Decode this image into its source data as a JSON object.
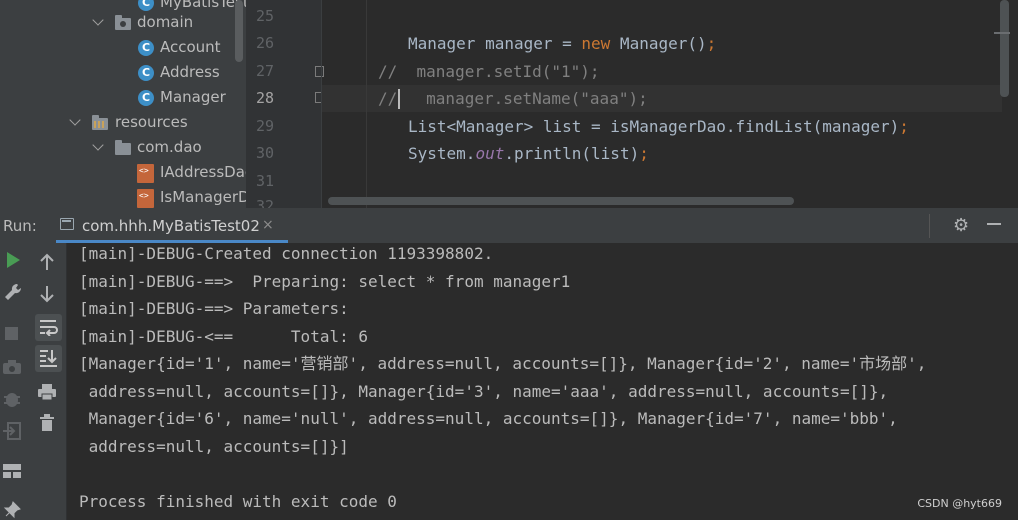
{
  "project_tree": {
    "items": [
      {
        "label": "MyBatisTest",
        "kind": "class"
      },
      {
        "label": "domain",
        "kind": "package"
      },
      {
        "label": "Account",
        "kind": "class"
      },
      {
        "label": "Address",
        "kind": "class"
      },
      {
        "label": "Manager",
        "kind": "class"
      },
      {
        "label": "resources",
        "kind": "resources"
      },
      {
        "label": "com.dao",
        "kind": "folder"
      },
      {
        "label": "IAddressDao",
        "kind": "xml"
      },
      {
        "label": "IsManagerD",
        "kind": "xml"
      }
    ]
  },
  "editor": {
    "line_numbers": [
      "25",
      "26",
      "27",
      "28",
      "29",
      "30",
      "31",
      "32"
    ],
    "current_line": "28",
    "code": {
      "l26_type": "Manager manager = ",
      "l26_new": "new",
      "l26_rest": " Manager()",
      "l26_semi": ";",
      "l27": "//  manager.setId(\"1\");",
      "l28": "//   manager.setName(\"aaa\");",
      "l29_a": "List<Manager> list = isManagerDao.findList(manager)",
      "l29_semi": ";",
      "l30_a": "System.",
      "l30_field": "out",
      "l30_b": ".println(list)",
      "l30_semi": ";"
    }
  },
  "run_panel": {
    "label": "Run:",
    "tab_title": "com.hhh.MyBatisTest02",
    "tab_close": "×",
    "settings_icon": "gear-icon",
    "minimize_icon": "minimize-icon"
  },
  "console": {
    "lines": [
      "[main]-DEBUG-Created connection 1193398802.",
      "[main]-DEBUG-==>  Preparing: select * from manager1",
      "[main]-DEBUG-==> Parameters:",
      "[main]-DEBUG-<==      Total: 6",
      "[Manager{id='1', name='营销部', address=null, accounts=[]}, Manager{id='2', name='市场部',",
      " address=null, accounts=[]}, Manager{id='3', name='aaa', address=null, accounts=[]},",
      " Manager{id='6', name='null', address=null, accounts=[]}, Manager{id='7', name='bbb',",
      " address=null, accounts=[]}]",
      "",
      "Process finished with exit code 0"
    ]
  },
  "watermark": "CSDN @hyt669",
  "colors": {
    "keyword": "#cc7832",
    "comment": "#808080",
    "static_field": "#9876aa",
    "accent": "#4a88c7",
    "run_green": "#499c54"
  }
}
